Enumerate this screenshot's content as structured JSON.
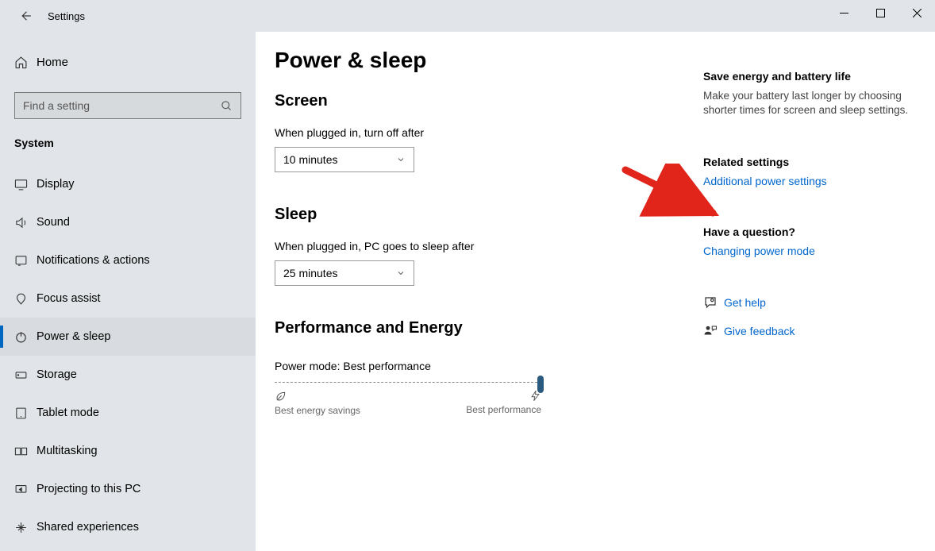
{
  "titlebar": {
    "title": "Settings"
  },
  "sidebar": {
    "home_label": "Home",
    "search_placeholder": "Find a setting",
    "group_label": "System",
    "items": [
      {
        "label": "Display",
        "icon": "display"
      },
      {
        "label": "Sound",
        "icon": "sound"
      },
      {
        "label": "Notifications & actions",
        "icon": "notifications"
      },
      {
        "label": "Focus assist",
        "icon": "focus"
      },
      {
        "label": "Power & sleep",
        "icon": "power",
        "selected": true
      },
      {
        "label": "Storage",
        "icon": "storage"
      },
      {
        "label": "Tablet mode",
        "icon": "tablet"
      },
      {
        "label": "Multitasking",
        "icon": "multitask"
      },
      {
        "label": "Projecting to this PC",
        "icon": "project"
      },
      {
        "label": "Shared experiences",
        "icon": "shared"
      }
    ]
  },
  "main": {
    "page_title": "Power & sleep",
    "screen": {
      "heading": "Screen",
      "label": "When plugged in, turn off after",
      "value": "10 minutes"
    },
    "sleep": {
      "heading": "Sleep",
      "label": "When plugged in, PC goes to sleep after",
      "value": "25 minutes"
    },
    "perf": {
      "heading": "Performance and Energy",
      "mode_prefix": "Power mode: ",
      "mode_value": "Best performance",
      "left_label": "Best energy savings",
      "right_label": "Best performance"
    }
  },
  "right": {
    "energy_heading": "Save energy and battery life",
    "energy_text": "Make your battery last longer by choosing shorter times for screen and sleep settings.",
    "related_heading": "Related settings",
    "related_link": "Additional power settings",
    "question_heading": "Have a question?",
    "question_link": "Changing power mode",
    "help_link": "Get help",
    "feedback_link": "Give feedback"
  }
}
